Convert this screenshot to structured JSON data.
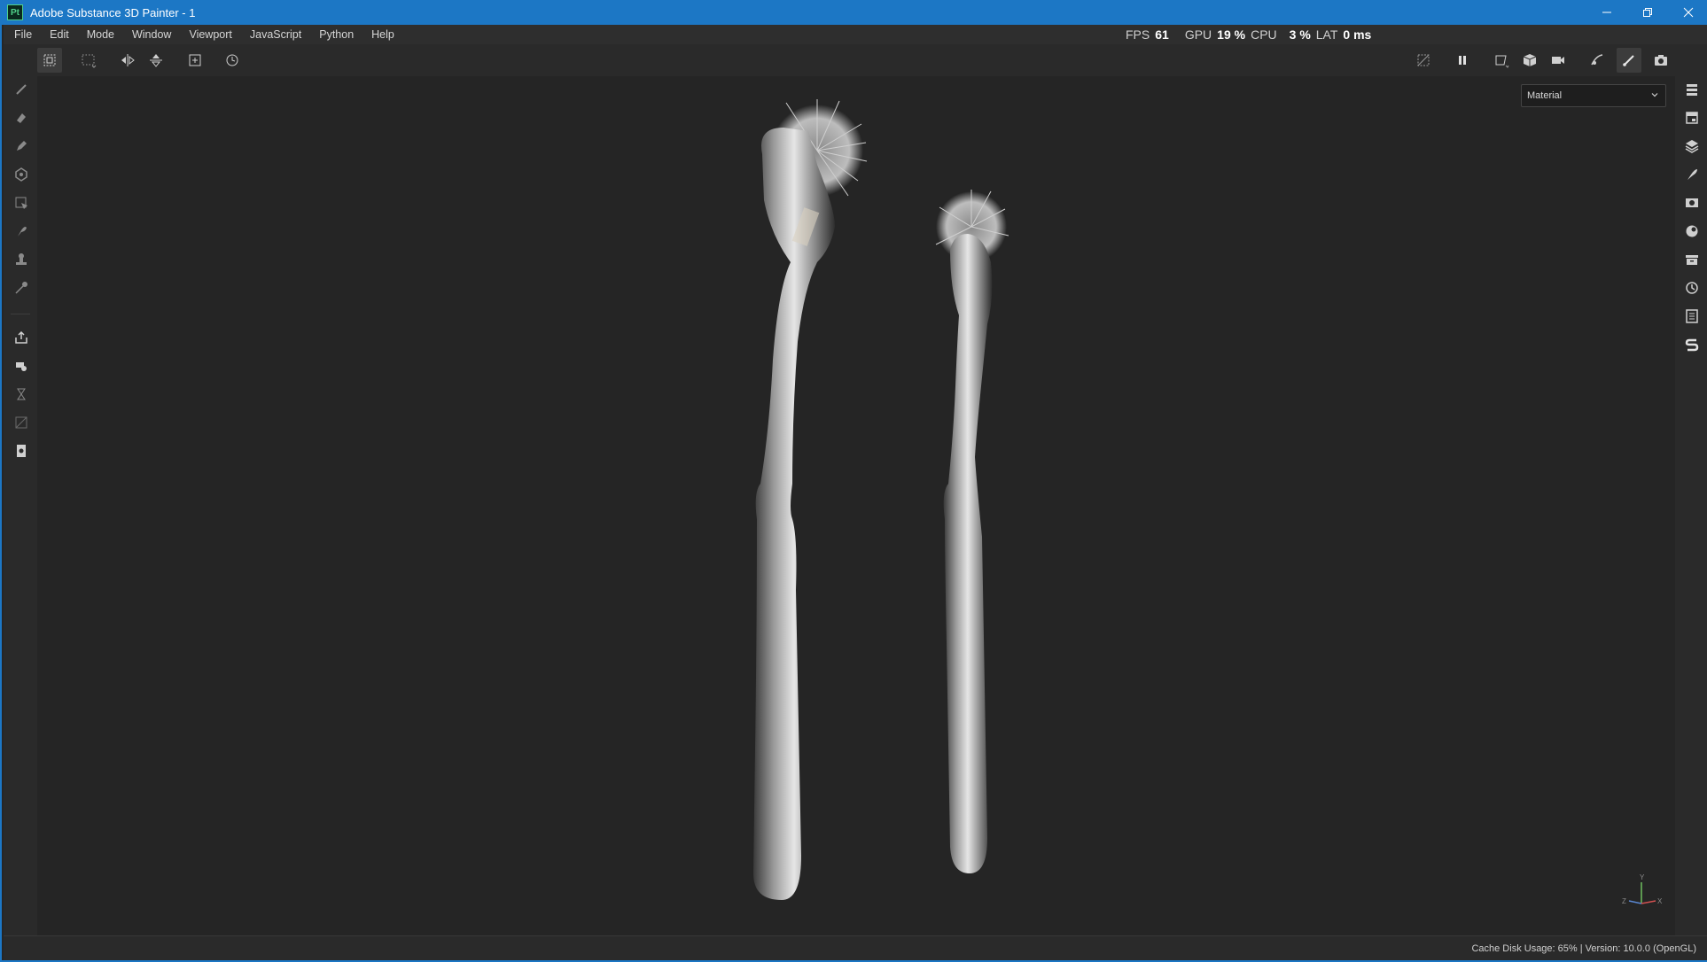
{
  "window": {
    "title": "Adobe Substance 3D Painter - 1",
    "app_badge": "Pt",
    "controls": [
      "minimize-icon",
      "restore-icon",
      "close-icon"
    ]
  },
  "menu": {
    "items": [
      "File",
      "Edit",
      "Mode",
      "Window",
      "Viewport",
      "JavaScript",
      "Python",
      "Help"
    ]
  },
  "performance": {
    "fps_label": "FPS",
    "fps_value": "61",
    "gpu_label": "GPU",
    "gpu_value": "19 %",
    "cpu_label": "CPU",
    "cpu_value": "3 %",
    "lat_label": "LAT",
    "lat_value": "0 ms"
  },
  "toolbar": {
    "left_tools": [
      "transform-grid-icon",
      "selection-grid-icon",
      "mirror-x-icon",
      "mirror-y-icon",
      "add-frame-icon",
      "reset-history-icon"
    ],
    "right_tools": [
      "hide-uv-icon",
      "pause-icon",
      "viewport-2d-icon",
      "cube-icon",
      "camera-icon",
      "bake-icon",
      "brush-icon",
      "screenshot-icon"
    ]
  },
  "left_tools": [
    "paint-icon",
    "eraser-icon",
    "projection-icon",
    "geometry-fill-icon",
    "polygon-fill-icon",
    "smudge-icon",
    "clone-icon",
    "color-picker-icon",
    "export-icon",
    "bake-mesh-icon",
    "history-icon",
    "uv-icon",
    "document-icon"
  ],
  "right_panels": [
    "layers-list-icon",
    "texture-set-icon",
    "layer-stack-icon",
    "properties-icon",
    "display-settings-icon",
    "shader-icon",
    "assets-icon",
    "history-panel-icon",
    "log-icon",
    "substance-icon"
  ],
  "viewport": {
    "display_mode": "Material",
    "axis_labels": {
      "y": "Y",
      "x": "X",
      "z": "Z"
    }
  },
  "status": {
    "text": "Cache Disk Usage:   65% | Version: 10.0.0 (OpenGL)"
  },
  "colors": {
    "title_bar": "#1c77c5",
    "chrome": "#2a2a2a",
    "viewport": "#252525"
  }
}
